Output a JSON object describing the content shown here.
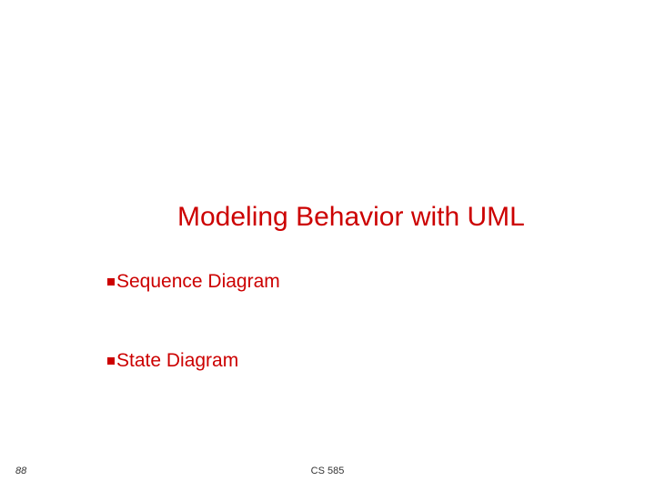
{
  "slide": {
    "title": "Modeling Behavior with UML",
    "bullets": [
      {
        "text": "Sequence Diagram"
      },
      {
        "text": "State Diagram"
      }
    ],
    "page_number": "88",
    "footer": "CS 585"
  },
  "colors": {
    "accent": "#cc0000"
  }
}
